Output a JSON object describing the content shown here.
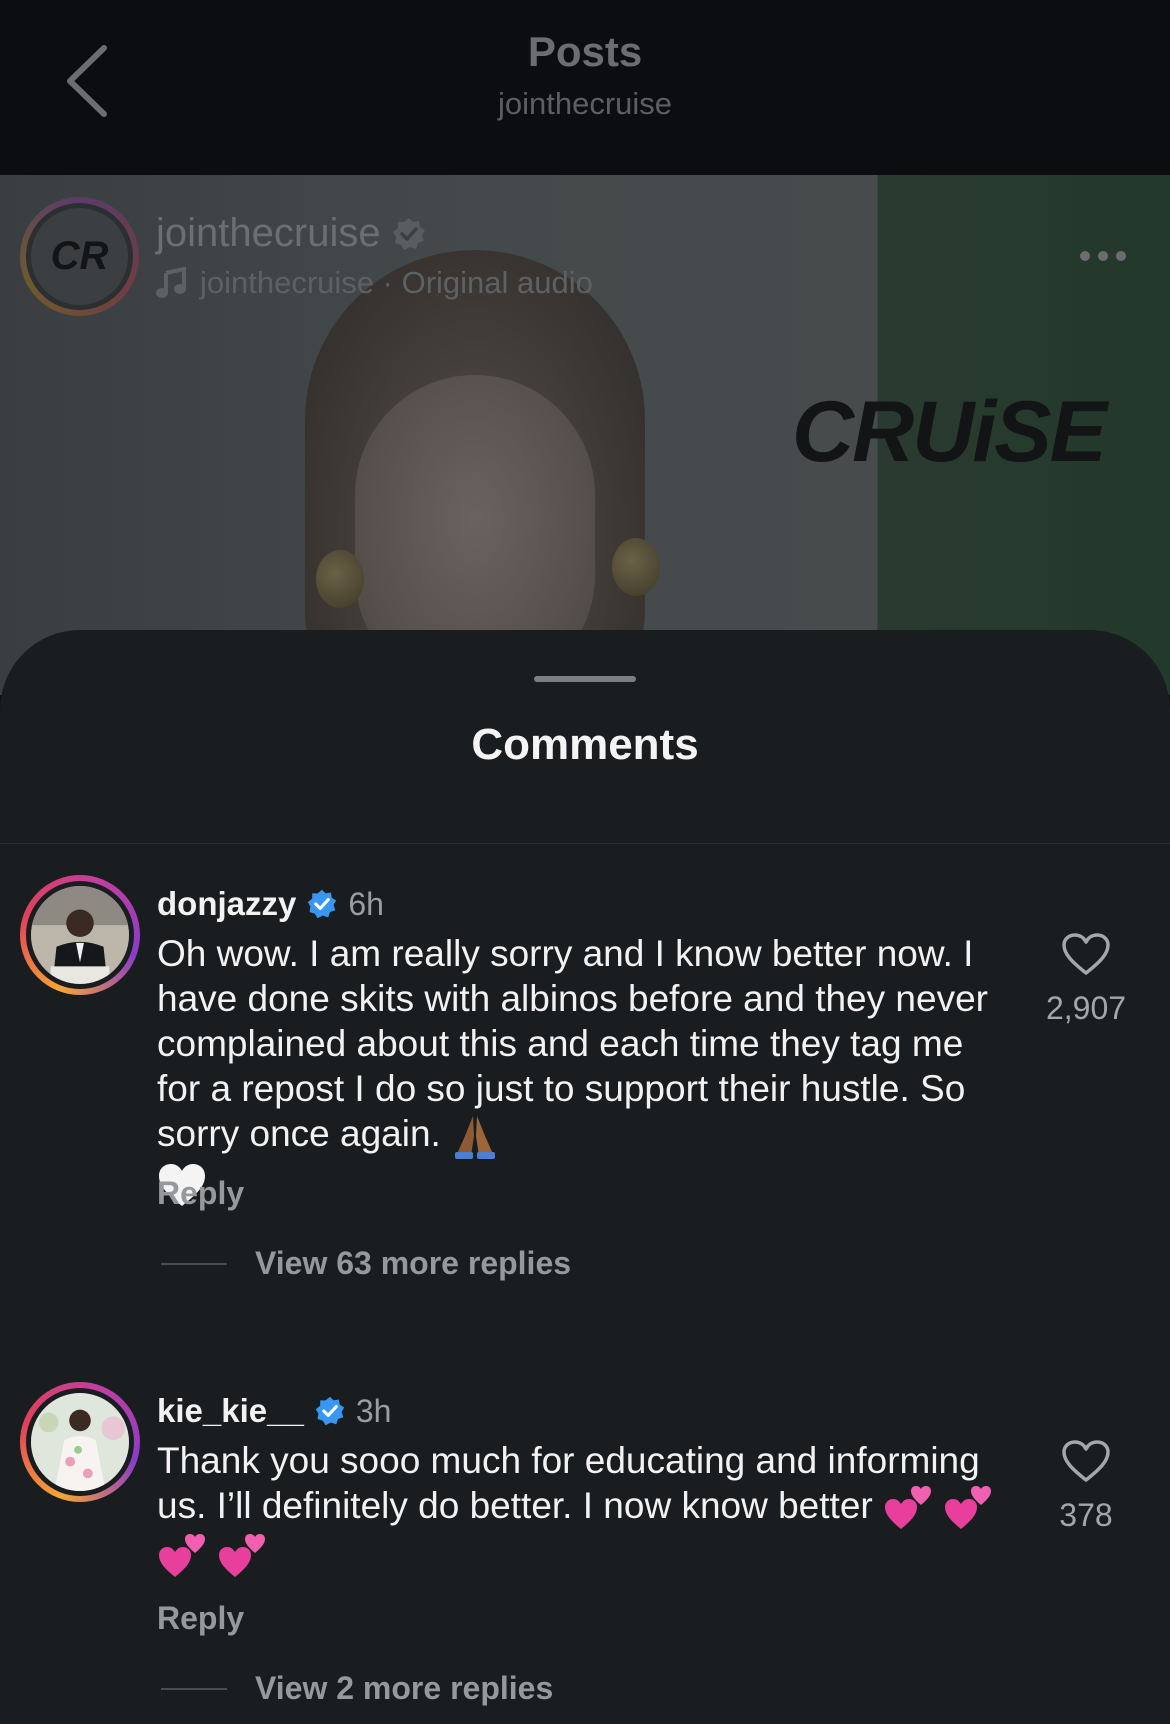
{
  "nav": {
    "title": "Posts",
    "subtitle": "jointhecruise"
  },
  "post": {
    "username": "jointhecruise",
    "audio": "jointhecruise · Original audio",
    "avatar_text": "CR",
    "brand_text": "CRUiSE"
  },
  "comments_sheet": {
    "title": "Comments",
    "items": [
      {
        "username": "donjazzy",
        "verified": true,
        "time": "6h",
        "text": "Oh wow. I am really sorry and I know better now. I have done skits with albinos before and they never complained about this and each time they tag me for a repost I do so just to support their hustle. So sorry once again.",
        "emojis": [
          "folded-hands",
          "white-heart"
        ],
        "likes": "2,907",
        "reply_label": "Reply",
        "more_replies": "View 63 more replies"
      },
      {
        "username": "kie_kie__",
        "verified": true,
        "time": "3h",
        "text": "Thank you sooo much for educating and informing us. I’ll definitely do better. I now know better",
        "emojis": [
          "two-hearts",
          "two-hearts",
          "two-hearts",
          "two-hearts"
        ],
        "likes": "378",
        "reply_label": "Reply",
        "more_replies": "View 2 more replies"
      }
    ]
  },
  "colors": {
    "sheet_bg": "#1a1d20",
    "verified": "#3897f0",
    "muted_text": "#95989c"
  }
}
